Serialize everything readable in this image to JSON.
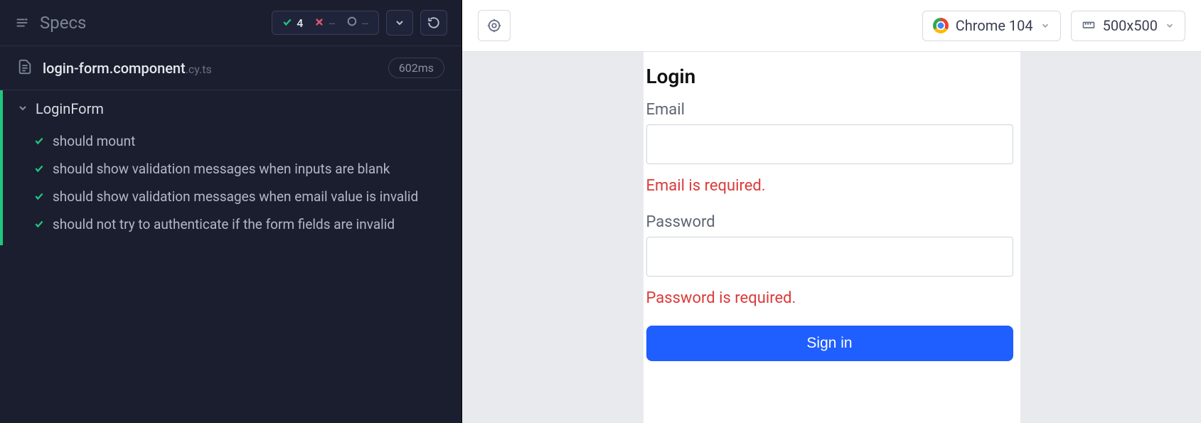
{
  "reporter": {
    "title": "Specs",
    "stats": {
      "passed": "4",
      "failed": "--",
      "pending": "--"
    },
    "spec_file": {
      "name": "login-form.component",
      "ext": ".cy.ts",
      "duration": "602ms"
    },
    "suite": {
      "title": "LoginForm",
      "tests": [
        {
          "title": "should mount"
        },
        {
          "title": "should show validation messages when inputs are blank"
        },
        {
          "title": "should show validation messages when email value is invalid"
        },
        {
          "title": "should not try to authenticate if the form fields are invalid"
        }
      ]
    }
  },
  "aut": {
    "browser": "Chrome 104",
    "viewport": "500x500"
  },
  "app": {
    "title": "Login",
    "email": {
      "label": "Email",
      "value": "",
      "error": "Email is required."
    },
    "password": {
      "label": "Password",
      "value": "",
      "error": "Password is required."
    },
    "submit": "Sign in"
  }
}
